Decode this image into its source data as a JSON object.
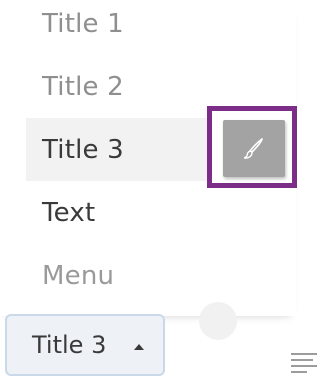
{
  "menu": {
    "items": [
      {
        "label": "Title 1"
      },
      {
        "label": "Title 2"
      },
      {
        "label": "Title 3"
      },
      {
        "label": "Text"
      },
      {
        "label": "Menu"
      }
    ],
    "selected_index": 2,
    "style_button_icon": "brush-icon",
    "highlight_color": "#7b2d87"
  },
  "toolbar": {
    "block_type_value": "Title 3",
    "caret_icon": "caret-up-icon",
    "color_icon": "color-circle-icon",
    "align_icon": "align-left-icon"
  }
}
